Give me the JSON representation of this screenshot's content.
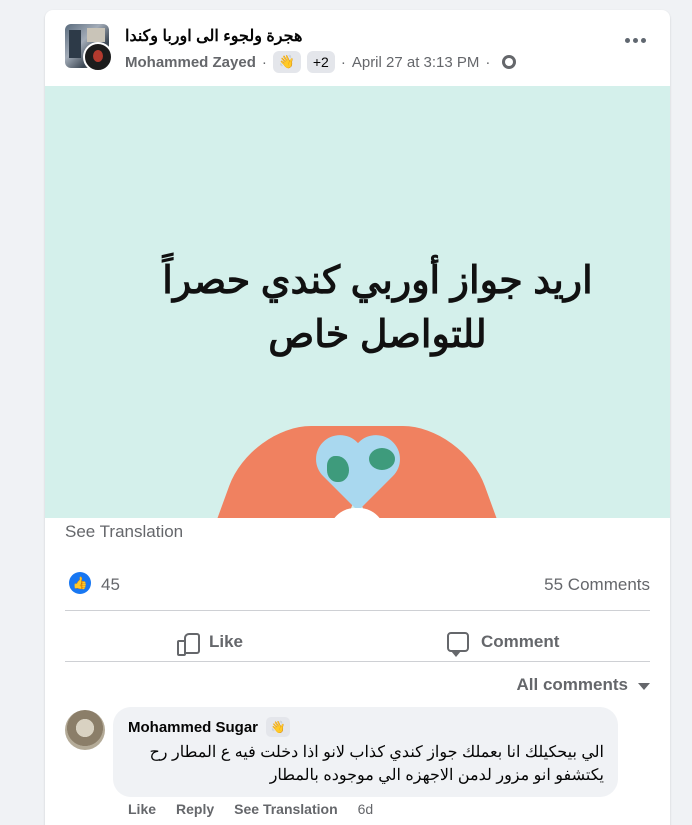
{
  "post": {
    "group_name": "هجرة ولجوء الى اوربا وكندا",
    "author": "Mohammed Zayed",
    "wave_badge": "👋",
    "extra_badges": "+2",
    "timestamp": "April 27 at 3:13 PM",
    "image_text_line1": "اريد جواز أوربي كندي حصراً",
    "image_text_line2": "للتواصل خاص",
    "see_translation": "See Translation",
    "like_count": "45",
    "comment_count": "55 Comments",
    "like_label": "Like",
    "comment_label": "Comment",
    "all_comments_label": "All comments",
    "colors": {
      "accent": "#1877f2",
      "image_bg": "#d4f0eb",
      "hands": "#f08160"
    }
  },
  "comment": {
    "author": "Mohammed Sugar",
    "wave_badge": "👋",
    "text": "الي بيحكيلك انا بعملك جواز كندي كذاب لانو اذا دخلت فيه ع المطار رح يكتشفو انو مزور لدمن الاجهزه الي موجوده بالمطار",
    "like": "Like",
    "reply": "Reply",
    "see_translation": "See Translation",
    "time": "6d"
  }
}
